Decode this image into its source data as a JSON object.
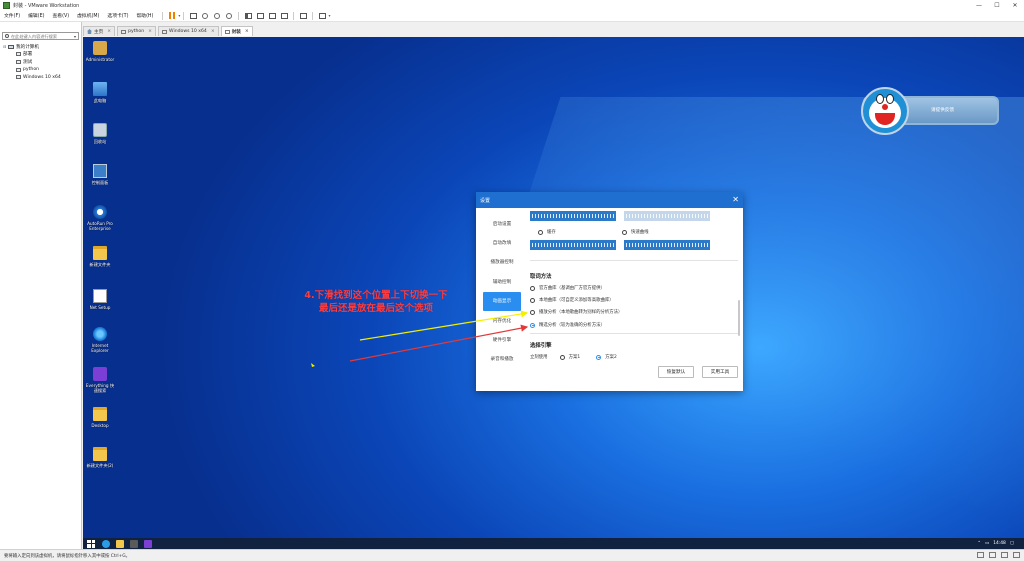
{
  "window": {
    "title": "封装 - VMware Workstation"
  },
  "menu": [
    "文件(F)",
    "编辑(E)",
    "查看(V)",
    "虚拟机(M)",
    "选项卡(T)",
    "帮助(H)"
  ],
  "library": {
    "search_placeholder": "在此处键入内容进行搜索",
    "root": "我的计算机",
    "items": [
      "部署",
      "测试",
      "python",
      "Windows 10 x64"
    ]
  },
  "tabs": [
    {
      "label": "主页"
    },
    {
      "label": "python"
    },
    {
      "label": "Windows 10 x64"
    },
    {
      "label": "封装"
    }
  ],
  "desktop_icons": [
    {
      "label": "Administrator"
    },
    {
      "label": "此电脑"
    },
    {
      "label": "回收站"
    },
    {
      "label": "控制面板"
    },
    {
      "label": "AutoRun Pro Enterprise"
    },
    {
      "label": "新建文件夹"
    },
    {
      "label": "Net Setup"
    },
    {
      "label": "Internet Explorer"
    },
    {
      "label": "Everything 快速搜索"
    },
    {
      "label": "Desktop"
    },
    {
      "label": "新建文件夹(2)"
    }
  ],
  "widget": {
    "label": "请提供反馈"
  },
  "annotation": {
    "line1": "4.下滑找到这个位置上下切换一下",
    "line2": "最后还是放在最后这个选项"
  },
  "dialog": {
    "title": "设置",
    "nav": [
      "启动设置",
      "自动改填",
      "播放器控制",
      "辅助控制",
      "动画显示",
      "内存优化",
      "硬件引擎",
      "录音和播放"
    ],
    "active_nav_index": 4,
    "wave_options": [
      "缓存",
      "快速曲线"
    ],
    "section1_title": "取词方法",
    "methods": [
      "官方曲库（基调由厂方官方提供）",
      "本地曲库（可自定义添加等高歌曲库）",
      "播放分析（本地歌曲转为别样的分析方法）",
      "精选分析（较为准确的分析方法）"
    ],
    "selected_method_index": 3,
    "section2_title": "选择引擎",
    "engine_label": "立刻使用",
    "engines": [
      "方案1",
      "方案2"
    ],
    "selected_engine_index": 1,
    "btn_default": "恢复默认",
    "btn_tools": "实用工具"
  },
  "taskbar": {
    "time": "14:48"
  },
  "statusbar": {
    "text": "要将输入定向到该虚拟机，请将鼠标指针移入其中或按 Ctrl+G。"
  },
  "colors": {
    "accent": "#2a8ef0",
    "annotation": "#ff3b3b",
    "yellow_arrow": "#f4f000",
    "red_arrow": "#e23a3a"
  }
}
